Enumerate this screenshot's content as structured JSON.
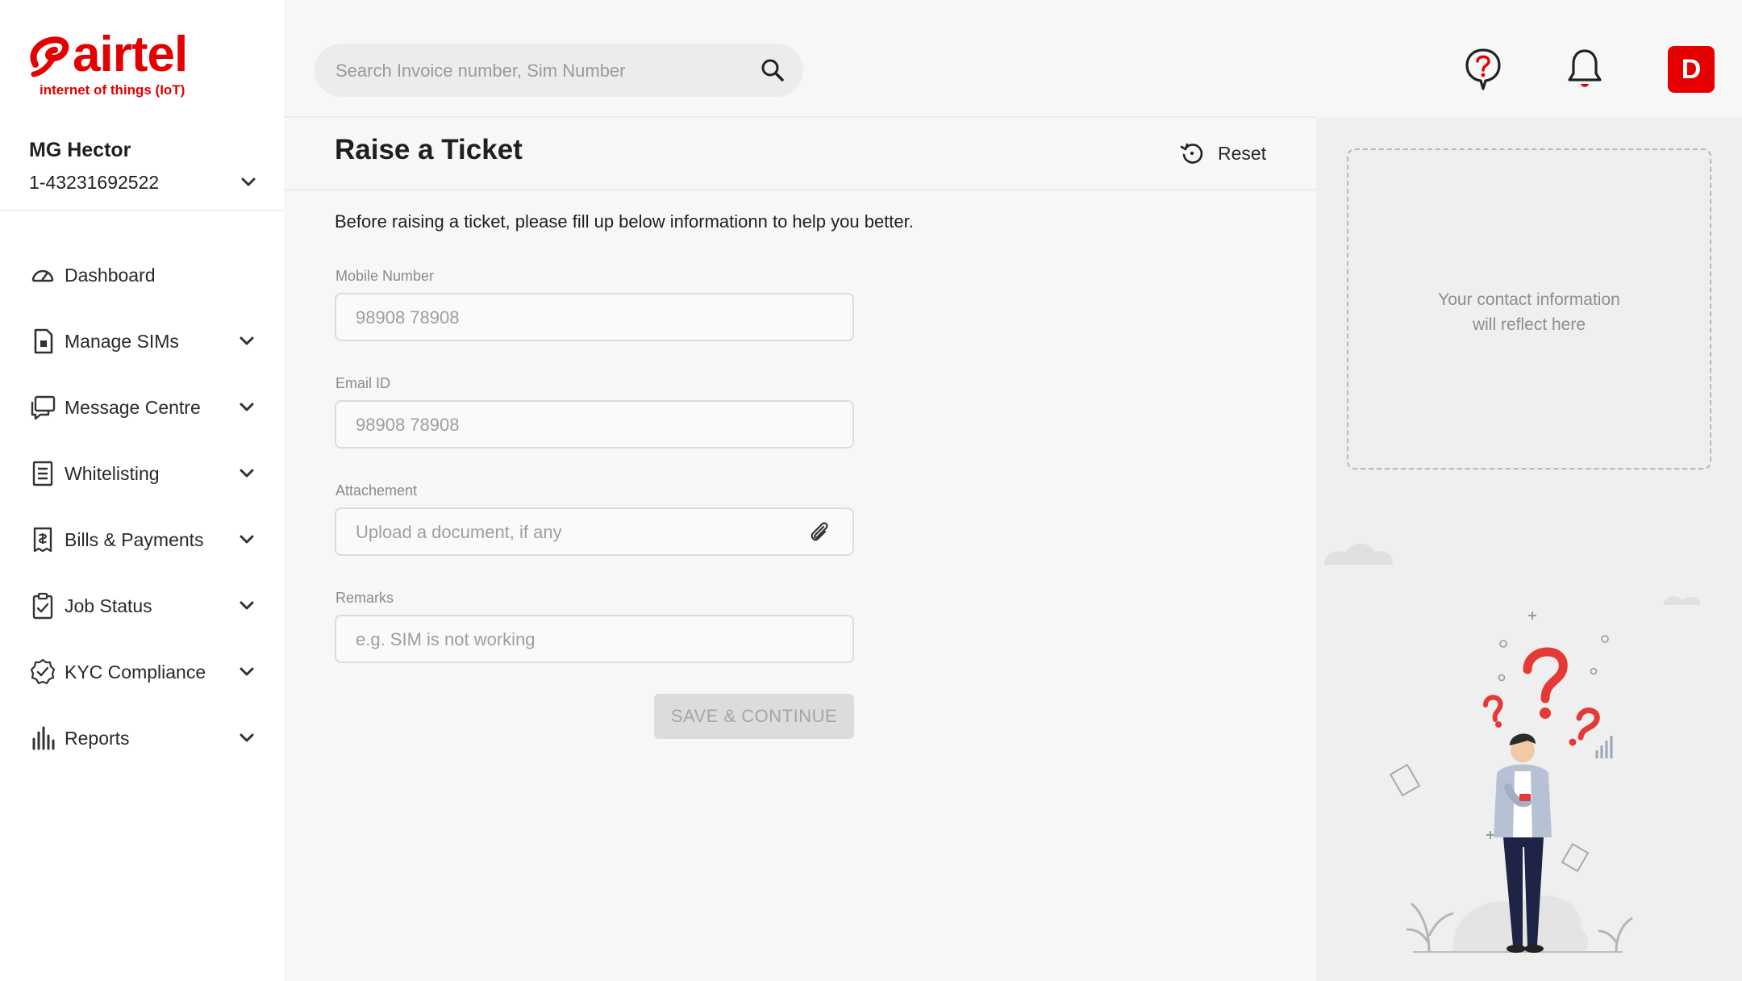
{
  "brand": {
    "name": "airtel",
    "tagline": "internet of things (IoT)",
    "accent_color": "#e40000"
  },
  "account": {
    "name": "MG Hector",
    "id": "1-43231692522"
  },
  "sidebar": {
    "items": [
      {
        "label": "Dashboard",
        "icon": "speedometer-icon"
      },
      {
        "label": "Manage SIMs",
        "icon": "sim-icon"
      },
      {
        "label": "Message Centre",
        "icon": "message-icon"
      },
      {
        "label": "Whitelisting",
        "icon": "document-list-icon"
      },
      {
        "label": "Bills & Payments",
        "icon": "bill-icon"
      },
      {
        "label": "Job Status",
        "icon": "clipboard-icon"
      },
      {
        "label": "KYC Compliance",
        "icon": "verified-badge-icon"
      },
      {
        "label": "Reports",
        "icon": "bar-chart-icon"
      }
    ]
  },
  "header": {
    "search_placeholder": "Search Invoice number, Sim Number",
    "avatar_initial": "D"
  },
  "main": {
    "title": "Raise a Ticket",
    "reset_label": "Reset",
    "intro": "Before raising a ticket, please fill up below informationn to help you better.",
    "fields": {
      "mobile": {
        "label": "Mobile Number",
        "placeholder": "98908 78908"
      },
      "email": {
        "label": "Email ID",
        "placeholder": "98908 78908"
      },
      "attachment": {
        "label": "Attachement",
        "placeholder": "Upload a document, if any"
      },
      "remarks": {
        "label": "Remarks",
        "placeholder": "e.g. SIM is not working"
      }
    },
    "submit_label": "SAVE & CONTINUE"
  },
  "right_panel": {
    "contact_line1": "Your contact  information",
    "contact_line2": "will reflect here"
  }
}
